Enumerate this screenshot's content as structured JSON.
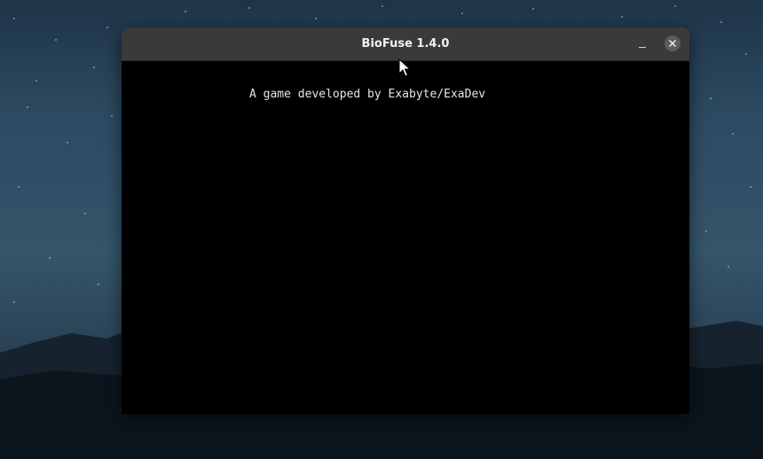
{
  "window": {
    "title": "BioFuse 1.4.0",
    "controls": {
      "minimize_icon": "minimize-icon",
      "close_icon": "close-icon"
    }
  },
  "content": {
    "credit_text": "A game developed by Exabyte/ExaDev",
    "background": "#000000"
  },
  "colors": {
    "titlebar": "#3a3a38",
    "title_text": "#f2f2f2",
    "content_text": "#e6e6e6"
  }
}
